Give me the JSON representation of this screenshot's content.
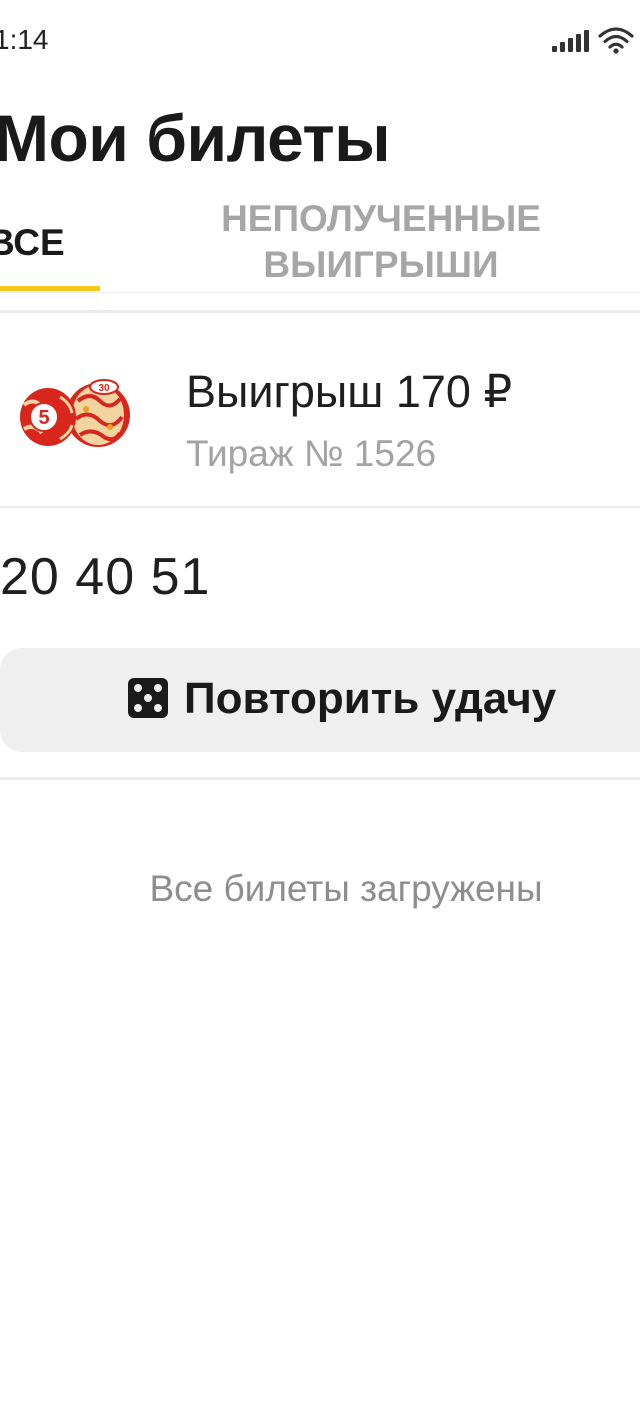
{
  "status_bar": {
    "time": "1:14",
    "icons": [
      "signal-icon",
      "wifi-icon"
    ]
  },
  "header": {
    "title": "Мои билеты"
  },
  "tabs": [
    {
      "label": "ВСЕ",
      "active": true
    },
    {
      "label": "НЕПОЛУЧЕННЫЕ ВЫИГРЫШИ",
      "active": false
    }
  ],
  "colors": {
    "accent": "#f5c518",
    "muted_text": "#a3a3a3",
    "button_bg": "#efefef"
  },
  "ticket": {
    "icon": "lotto-barrels-icon",
    "win_amount": "Выигрыш 170 ₽",
    "draw_number": "Тираж № 1526",
    "numbers": "20 40 51",
    "repeat_button": {
      "icon": "dice-icon",
      "label": "Повторить удачу"
    }
  },
  "footer": {
    "all_loaded": "Все билеты загружены"
  }
}
